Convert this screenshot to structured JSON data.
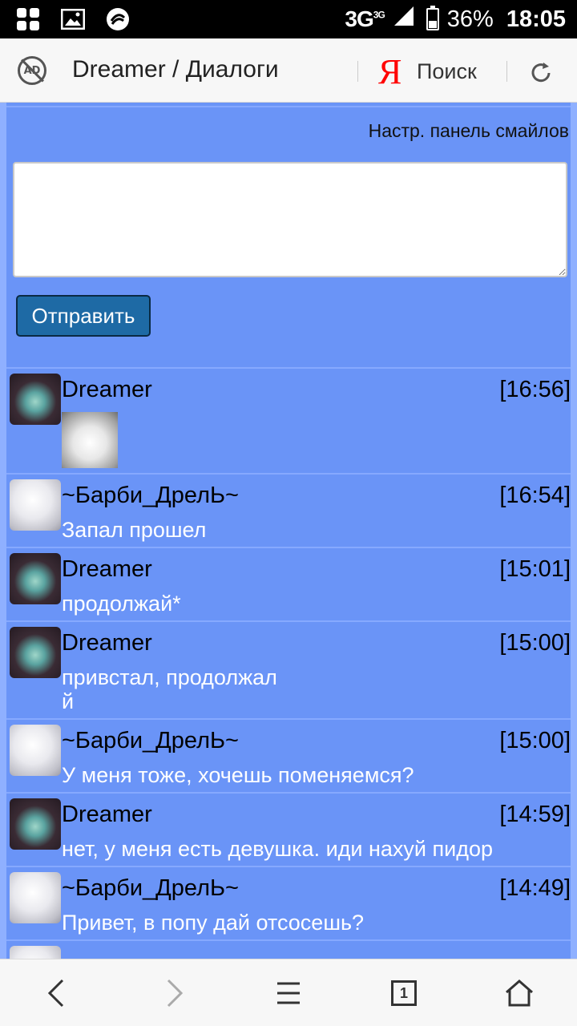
{
  "status_bar": {
    "network": "3G",
    "network_sup": "3G",
    "battery": "36%",
    "battery_level": 0.36,
    "time": "18:05"
  },
  "browser": {
    "adblock_label": "AD",
    "page_title": "Dreamer / Диалоги",
    "yandex_logo": "Я",
    "search_label": "Поиск"
  },
  "compose": {
    "smiles_link": "Настр. панель смайлов",
    "message_value": "",
    "send_label": "Отправить"
  },
  "messages": [
    {
      "author": "Dreamer",
      "time": "[16:56]",
      "text": "",
      "avatar": "dark",
      "sticker": true
    },
    {
      "author": "~Барби_ДрелЬ~",
      "time": "[16:54]",
      "text": "Запал прошел",
      "avatar": "light"
    },
    {
      "author": "Dreamer",
      "time": "[15:01]",
      "text": "продолжай*",
      "avatar": "dark"
    },
    {
      "author": "Dreamer",
      "time": "[15:00]",
      "text": "привстал, продолжал\nй",
      "avatar": "dark"
    },
    {
      "author": "~Барби_ДрелЬ~",
      "time": "[15:00]",
      "text": "У меня тоже, хочешь поменяемся?",
      "avatar": "light"
    },
    {
      "author": "Dreamer",
      "time": "[14:59]",
      "text": "нет, у меня есть девушка. иди нахуй пидор",
      "avatar": "dark"
    },
    {
      "author": "~Барби_ДрелЬ~",
      "time": "[14:49]",
      "text": "Привет, в попу дай отсосешь?",
      "avatar": "light"
    }
  ],
  "bottom_nav": {
    "tab_count": "1"
  },
  "colors": {
    "page_bg": "#6a94f7",
    "send_button": "#1e6aa5",
    "yandex_red": "#ff0000"
  }
}
